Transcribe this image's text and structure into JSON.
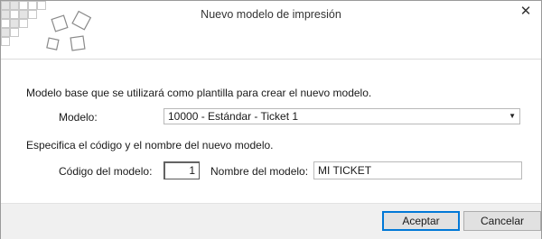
{
  "dialog": {
    "title": "Nuevo modelo de impresión",
    "close_glyph": "✕",
    "close_icon": "close-icon",
    "logo_icon": "squares-logo-icon"
  },
  "base_model": {
    "description": "Modelo base que se utilizará como plantilla para crear el nuevo modelo.",
    "model_label": "Modelo:",
    "model_selected": "10000 - Estándar - Ticket 1",
    "dropdown_icon": "chevron-down-icon"
  },
  "new_model": {
    "description": "Especifica el código y el nombre del nuevo modelo.",
    "code_label": "Código del modelo:",
    "code_value": "1",
    "name_label": "Nombre del modelo:",
    "name_value": "MI TICKET"
  },
  "buttons": {
    "accept": "Aceptar",
    "cancel": "Cancelar"
  },
  "colors": {
    "accent": "#0078d7",
    "footer_bg": "#f0f0f0",
    "button_bg": "#e1e1e1"
  }
}
